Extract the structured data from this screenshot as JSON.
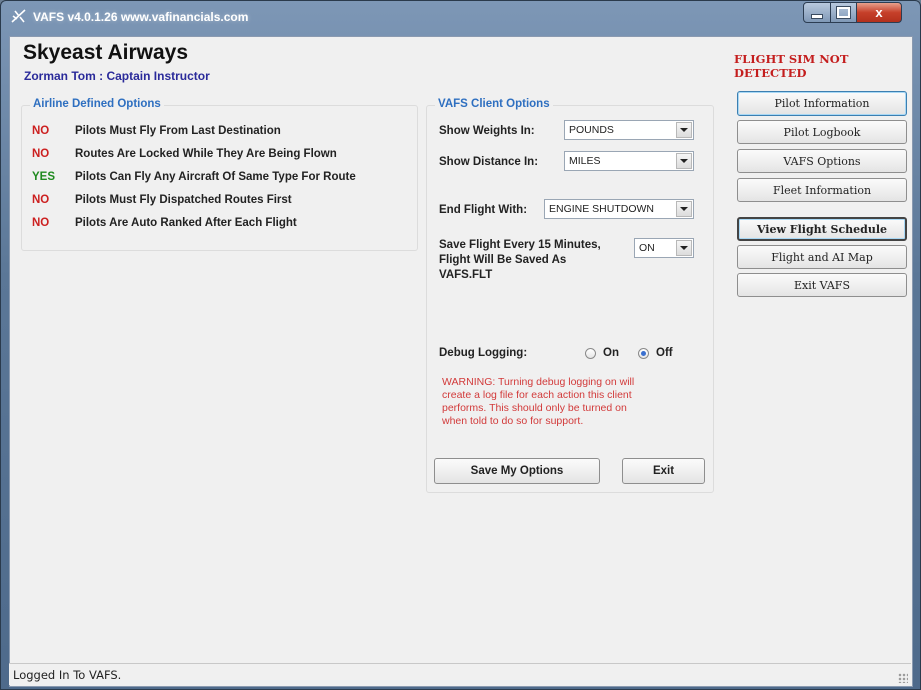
{
  "window": {
    "title": "VAFS v4.0.1.26 www.vafinancials.com",
    "close_glyph": "x"
  },
  "header": {
    "airline": "Skyeast Airways",
    "pilot": "Zorman Tom : Captain Instructor",
    "sim_status": "FLIGHT SIM NOT DETECTED"
  },
  "airline_options": {
    "title": "Airline Defined Options",
    "items": [
      {
        "value": "NO",
        "label": "Pilots Must Fly From Last Destination"
      },
      {
        "value": "NO",
        "label": "Routes Are Locked While They Are Being Flown"
      },
      {
        "value": "YES",
        "label": "Pilots Can Fly Any Aircraft Of Same Type For Route"
      },
      {
        "value": "NO",
        "label": "Pilots Must Fly Dispatched Routes First"
      },
      {
        "value": "NO",
        "label": "Pilots Are Auto Ranked After Each Flight"
      }
    ]
  },
  "client_options": {
    "title": "VAFS Client Options",
    "weights_label": "Show Weights In:",
    "weights_value": "POUNDS",
    "distance_label": "Show Distance In:",
    "distance_value": "MILES",
    "end_flight_label": "End Flight With:",
    "end_flight_value": "ENGINE SHUTDOWN",
    "save_flight_label_1": "Save Flight Every 15 Minutes,",
    "save_flight_label_2": "Flight Will Be Saved As",
    "save_flight_label_3": "VAFS.FLT",
    "save_flight_value": "ON",
    "debug_label": "Debug  Logging:",
    "debug_on": "On",
    "debug_off": "Off",
    "debug_selected": "Off",
    "warning_1": "WARNING: Turning debug logging on will",
    "warning_2": "create a log file for each action this client",
    "warning_3": "performs. This should only be turned on",
    "warning_4": "when told to do so for support.",
    "save_button": "Save My Options",
    "exit_button": "Exit"
  },
  "nav": {
    "pilot_info": "Pilot Information",
    "pilot_logbook": "Pilot Logbook",
    "vafs_options": "VAFS Options",
    "fleet_info": "Fleet Information",
    "flight_schedule": "View Flight Schedule",
    "flight_map": "Flight and AI Map",
    "exit_vafs": "Exit VAFS"
  },
  "status": {
    "text": "Logged In To VAFS."
  },
  "colors": {
    "no": "#cc2020",
    "yes": "#1f8a1f",
    "group_title": "#2e6fc0",
    "warning": "#d23a3a",
    "pilot_name": "#2a2a9a"
  }
}
